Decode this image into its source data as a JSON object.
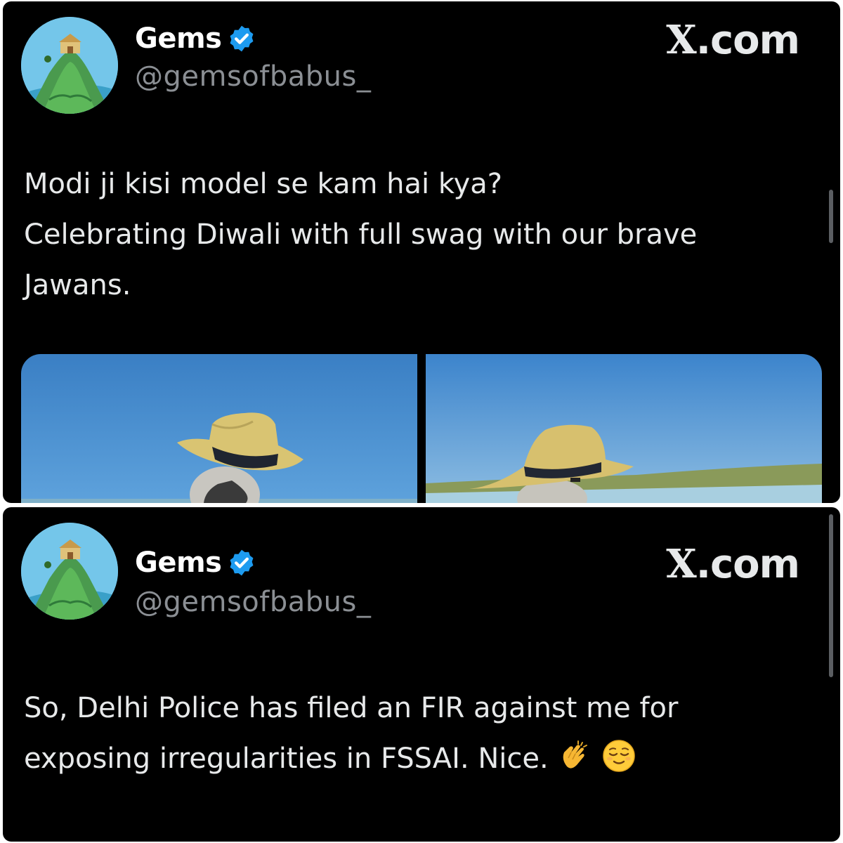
{
  "tweets": [
    {
      "author_name": "Gems",
      "handle": "@gemsofbabus_",
      "brand": "X.com",
      "text_lines": [
        "Modi ji kisi model se kam hai kya?",
        "Celebrating Diwali with full swag with our brave",
        "Jawans."
      ],
      "media_count": 2
    },
    {
      "author_name": "Gems",
      "handle": "@gemsofbabus_",
      "brand": "X.com",
      "text_lines": [
        "So, Delhi Police has filed an FIR against me for",
        "exposing irregularities in FSSAI. Nice."
      ],
      "emojis": [
        "clapping-hands",
        "relieved-face"
      ]
    }
  ],
  "colors": {
    "background": "#000000",
    "text": "#e7e9ea",
    "handle": "#8b8f94",
    "verified": "#1d9bf0",
    "sky": "#3f86c9"
  }
}
